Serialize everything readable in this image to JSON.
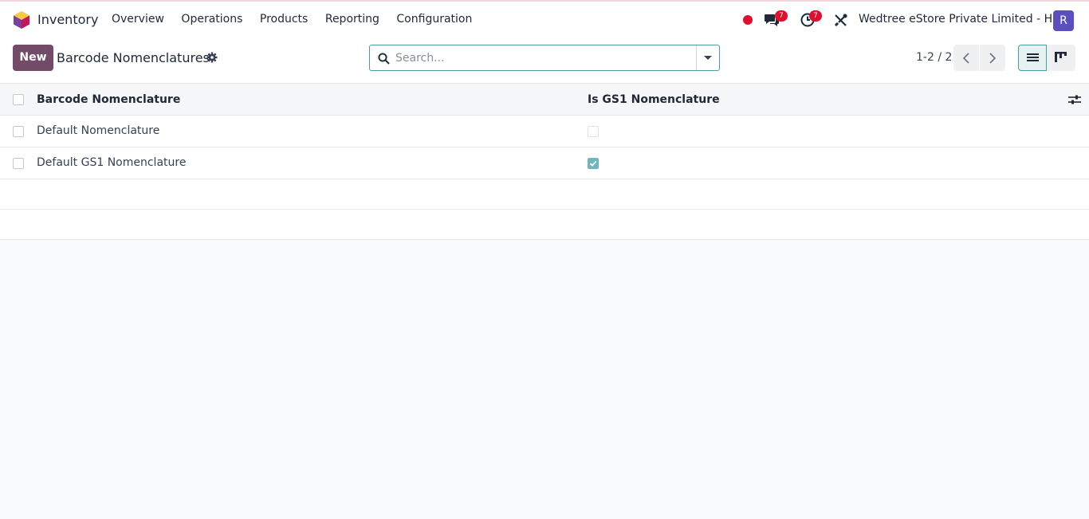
{
  "navbar": {
    "app_name": "Inventory",
    "menu": [
      "Overview",
      "Operations",
      "Products",
      "Reporting",
      "Configuration"
    ],
    "messages_count": "7",
    "activities_count": "7",
    "company": "Wedtree eStore Private Limited - HO",
    "avatar_initial": "R"
  },
  "control": {
    "new_label": "New",
    "breadcrumb": "Barcode Nomenclatures",
    "search_placeholder": "Search...",
    "pager": "1-2 / 2"
  },
  "table": {
    "columns": [
      "Barcode Nomenclature",
      "Is GS1 Nomenclature"
    ],
    "rows": [
      {
        "name": "Default Nomenclature",
        "is_gs1": false
      },
      {
        "name": "Default GS1 Nomenclature",
        "is_gs1": true
      }
    ]
  },
  "colors": {
    "brand": "#714b67",
    "accent": "#4f9aa3",
    "badge": "#e0102d",
    "avatar": "#5b4fbf"
  }
}
